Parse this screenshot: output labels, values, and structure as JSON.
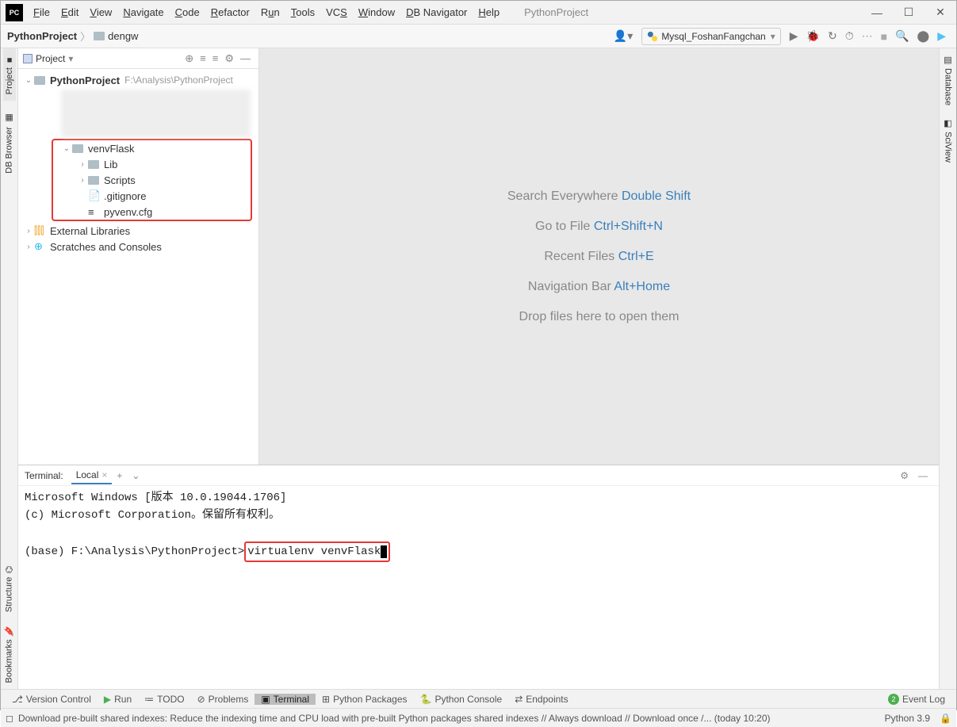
{
  "titlebar": {
    "app_title": "PythonProject",
    "menus": [
      "File",
      "Edit",
      "View",
      "Navigate",
      "Code",
      "Refactor",
      "Run",
      "Tools",
      "VCS",
      "Window",
      "DB Navigator",
      "Help"
    ]
  },
  "breadcrumb": {
    "root": "PythonProject",
    "child": "dengw"
  },
  "run_config": {
    "label": "Mysql_FoshanFangchan"
  },
  "project_panel": {
    "title": "Project",
    "root_name": "PythonProject",
    "root_path": "F:\\Analysis\\PythonProject",
    "venv": {
      "name": "venvFlask",
      "children": [
        "Lib",
        "Scripts",
        ".gitignore",
        "pyvenv.cfg"
      ]
    },
    "ext_lib": "External Libraries",
    "scratches": "Scratches and Consoles"
  },
  "editor_hints": {
    "h1_label": "Search Everywhere",
    "h1_key": "Double Shift",
    "h2_label": "Go to File",
    "h2_key": "Ctrl+Shift+N",
    "h3_label": "Recent Files",
    "h3_key": "Ctrl+E",
    "h4_label": "Navigation Bar",
    "h4_key": "Alt+Home",
    "h5_label": "Drop files here to open them"
  },
  "terminal": {
    "panel_label": "Terminal:",
    "tab_label": "Local",
    "line1": "Microsoft Windows [版本 10.0.19044.1706]",
    "line2": "(c) Microsoft Corporation。保留所有权利。",
    "prompt": "(base) F:\\Analysis\\PythonProject>",
    "command": "virtualenv venvFlask"
  },
  "left_tabs": {
    "project": "Project",
    "db": "DB Browser"
  },
  "left_bottom_tabs": {
    "bookmarks": "Bookmarks",
    "structure": "Structure"
  },
  "right_tabs": {
    "db": "Database",
    "sci": "SciView"
  },
  "bottom_bar": {
    "vc": "Version Control",
    "run": "Run",
    "todo": "TODO",
    "problems": "Problems",
    "terminal": "Terminal",
    "pkg": "Python Packages",
    "console": "Python Console",
    "endpoints": "Endpoints",
    "eventlog": "Event Log",
    "event_count": "2"
  },
  "status": {
    "msg": "Download pre-built shared indexes: Reduce the indexing time and CPU load with pre-built Python packages shared indexes // Always download // Download once /... (today 10:20)",
    "python": "Python 3.9"
  }
}
